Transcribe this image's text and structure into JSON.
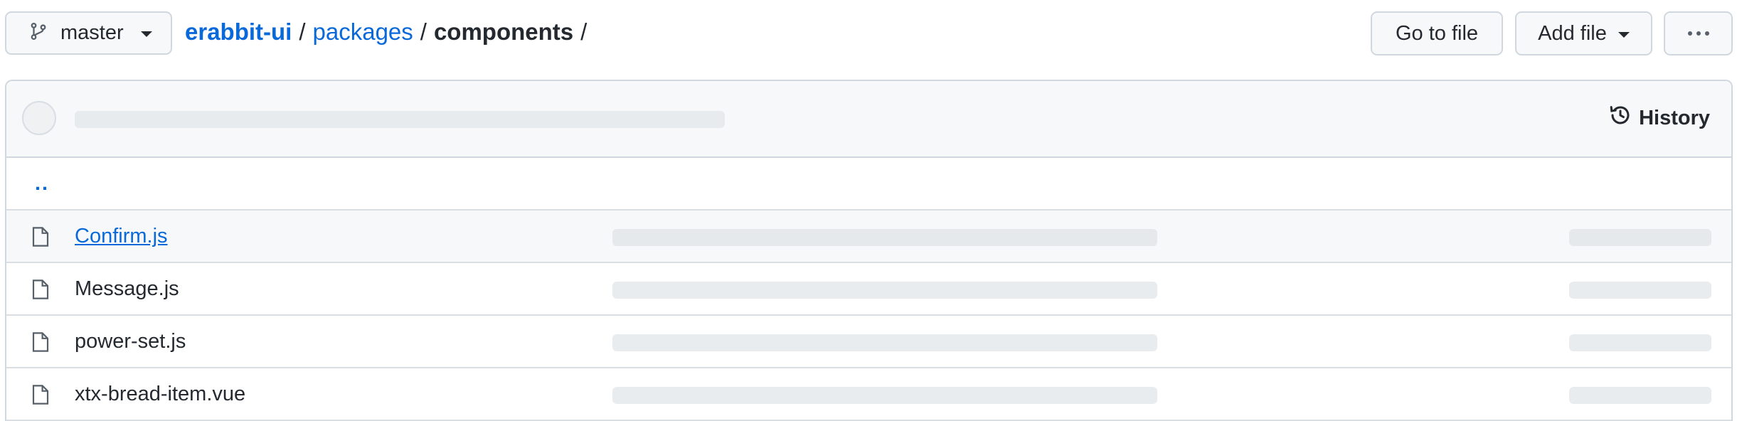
{
  "branch": {
    "label": "master",
    "icon": "git-branch-icon"
  },
  "breadcrumb": {
    "repo": "erabbit-ui",
    "sep": "/",
    "packages": "packages",
    "current": "components"
  },
  "actions": {
    "go_to_file": "Go to file",
    "add_file": "Add file",
    "more_icon": "kebab-horizontal-icon"
  },
  "commit_header": {
    "history_label": "History",
    "history_icon": "history-icon"
  },
  "parent_dir": "..",
  "files": [
    {
      "name": "Confirm.js",
      "icon": "file-icon",
      "state": "hovered-link"
    },
    {
      "name": "Message.js",
      "icon": "file-icon",
      "state": "normal"
    },
    {
      "name": "power-set.js",
      "icon": "file-icon",
      "state": "normal"
    },
    {
      "name": "xtx-bread-item.vue",
      "icon": "file-icon",
      "state": "normal"
    }
  ],
  "colors": {
    "link": "#0969da",
    "text": "#24292f",
    "border": "#d0d7de",
    "header_bg": "#f6f8fa",
    "skeleton": "#e9ecef"
  }
}
